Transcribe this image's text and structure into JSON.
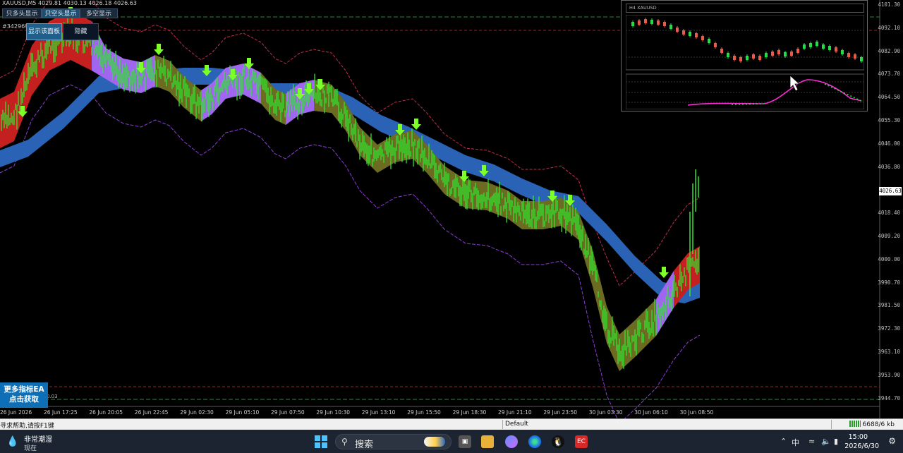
{
  "chart": {
    "symbol_info": "XAUUSD,M5  4029.81 4030.13 4026.18 4026.63",
    "account_line": "#34296999",
    "buttons": [
      "只多头显示",
      "只空头显示",
      "多空显示"
    ],
    "panel_buttons": [
      "显示该面板",
      "隐藏"
    ],
    "current_price": "4026.63",
    "low_tag": "0.03",
    "price_axis": [
      "4101.30",
      "4092.10",
      "4082.90",
      "4073.70",
      "4064.50",
      "4055.30",
      "4046.00",
      "4036.80",
      "4018.40",
      "4009.20",
      "4000.00",
      "3990.70",
      "3981.50",
      "3972.30",
      "3963.10",
      "3953.90",
      "3944.70"
    ],
    "time_axis": [
      "26 Jun 2026",
      "26 Jun 17:25",
      "26 Jun 20:05",
      "26 Jun 22:45",
      "29 Jun 02:30",
      "29 Jun 05:10",
      "29 Jun 07:50",
      "29 Jun 10:30",
      "29 Jun 13:10",
      "29 Jun 15:50",
      "29 Jun 18:30",
      "29 Jun 21:10",
      "29 Jun 23:50",
      "30 Jun 03:30",
      "30 Jun 06:10",
      "30 Jun 08:50"
    ],
    "colors": {
      "bg": "#000000",
      "candle": "#2ee62e",
      "ribbon_bull": "#6b6b22",
      "ribbon_bear": "#c42020",
      "ribbon_purple": "#a066f0",
      "blue_band": "#2a63b6",
      "arrow": "#7dff2a",
      "envelope_upper": "#c0304a",
      "envelope_lower": "#8b3fd6"
    }
  },
  "mini_panel": {
    "title": "H4  XAUUSD",
    "colors": {
      "bull": "#22dd44",
      "bear": "#e85a4a",
      "line": "#ff2ad6"
    }
  },
  "promo": {
    "line1": "更多指标EA",
    "line2": "点击获取"
  },
  "statusbar": {
    "help": "寻求帮助,请按F1键",
    "profile": "Default",
    "traffic": "6688/6 kb"
  },
  "taskbar": {
    "weather_title": "非常潮湿",
    "weather_sub": "现在",
    "search_placeholder": "搜索",
    "ime": "中",
    "time": "15:00",
    "date": "2026/6/30"
  }
}
